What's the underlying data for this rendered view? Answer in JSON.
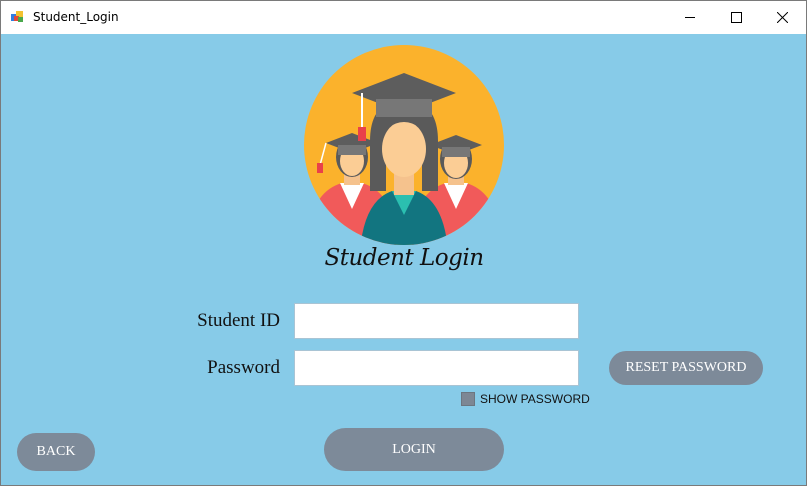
{
  "window": {
    "title": "Student_Login"
  },
  "logo": {
    "title": "Student Login",
    "icon": "graduates-icon"
  },
  "form": {
    "student_id_label": "Student ID",
    "student_id_value": "",
    "password_label": "Password",
    "password_value": "",
    "show_password_label": "SHOW PASSWORD",
    "show_password_checked": false
  },
  "buttons": {
    "reset_password": "RESET PASSWORD",
    "login": "LOGIN",
    "back": "BACK"
  },
  "colors": {
    "background": "#87cbe8",
    "button": "#7d8a99",
    "logo_circle": "#fbb22c"
  }
}
